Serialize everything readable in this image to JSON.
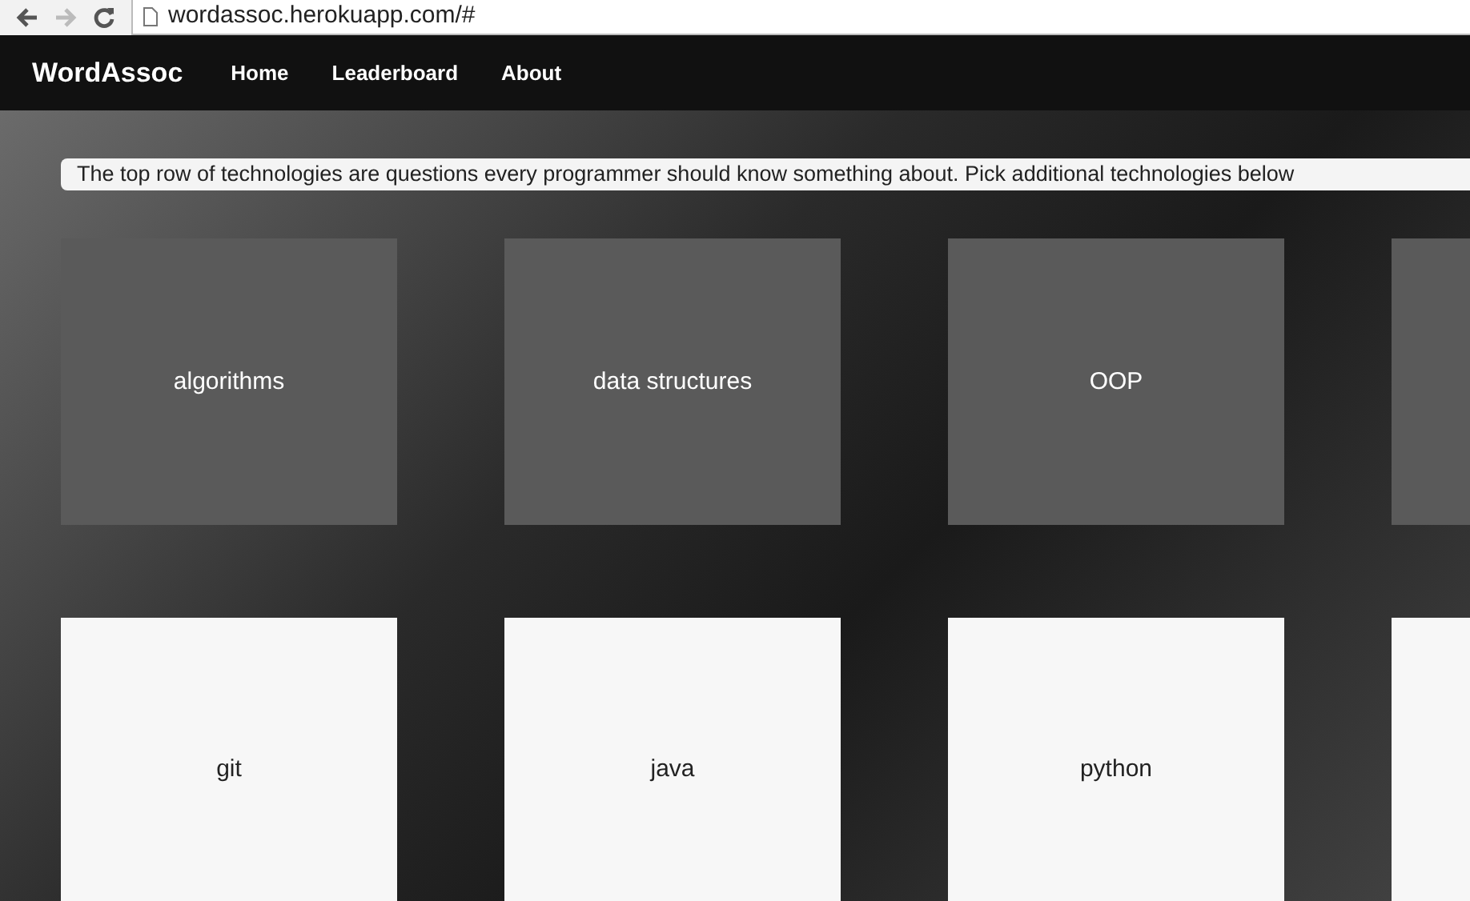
{
  "browser": {
    "url": "wordassoc.herokuapp.com/#"
  },
  "navbar": {
    "brand": "WordAssoc",
    "links": [
      {
        "label": "Home"
      },
      {
        "label": "Leaderboard"
      },
      {
        "label": "About"
      }
    ]
  },
  "intro": "The top row of technologies are questions every programmer should know something about. Pick additional technologies below",
  "top_row": [
    {
      "label": "algorithms"
    },
    {
      "label": "data structures"
    },
    {
      "label": "OOP"
    }
  ],
  "bottom_row": [
    {
      "label": "git"
    },
    {
      "label": "java"
    },
    {
      "label": "python"
    }
  ]
}
